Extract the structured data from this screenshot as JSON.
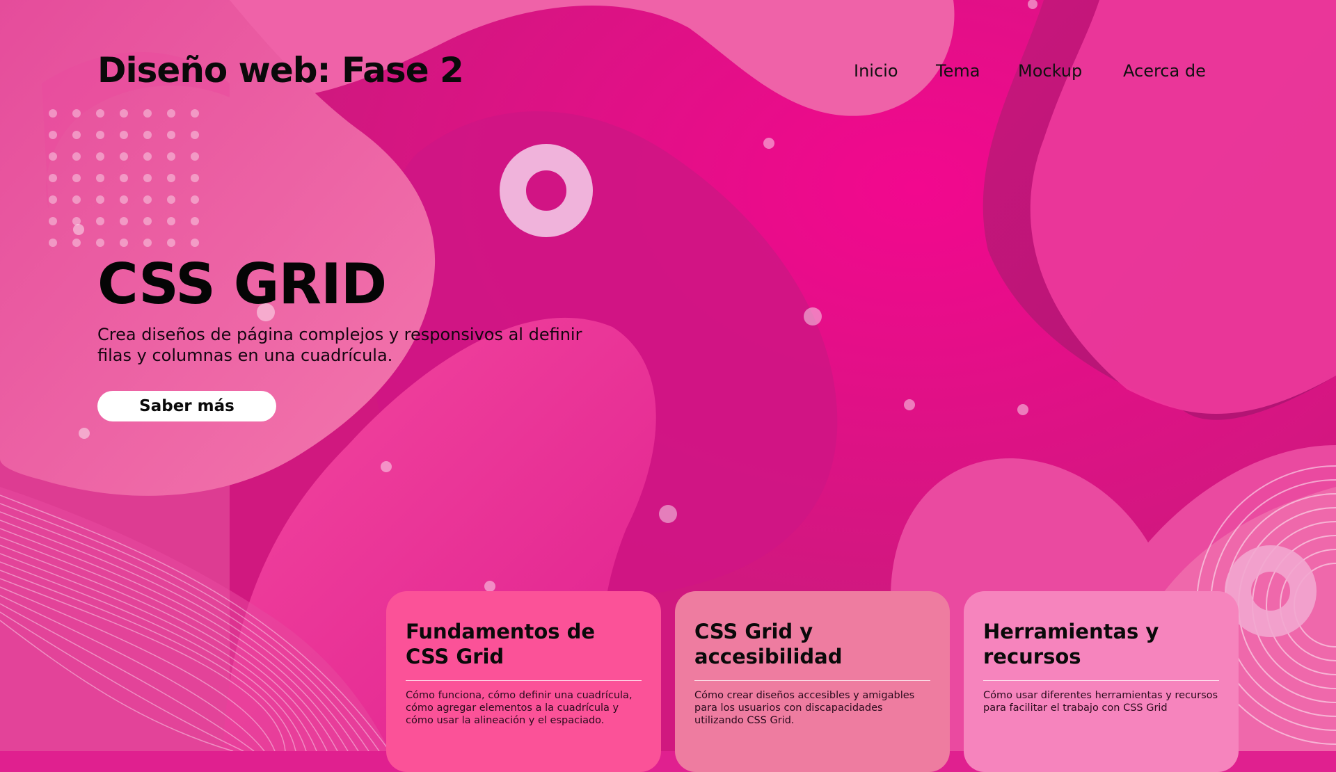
{
  "site": {
    "title": "Diseño web: Fase 2"
  },
  "nav": {
    "items": [
      "Inicio",
      "Tema",
      "Mockup",
      "Acerca de"
    ]
  },
  "hero": {
    "title": "CSS GRID",
    "description": "Crea diseños de página complejos y responsivos al definir filas y columnas en una cuadrícula.",
    "button": "Saber más"
  },
  "cards": [
    {
      "title": "Fundamentos de CSS Grid",
      "text": "Cómo funciona, cómo definir una cuadrícula, cómo agregar elementos a la cuadrícula y cómo usar la alineación y el espaciado.",
      "color": "#fb5298"
    },
    {
      "title": "CSS Grid y accesibilidad",
      "text": "Cómo crear diseños accesibles y amigables para los usuarios con discapacidades utilizando CSS Grid.",
      "color": "#ee7ca0"
    },
    {
      "title": "Herramientas y recursos",
      "text": "Cómo usar diferentes herramientas y recursos para facilitar el trabajo con CSS Grid",
      "color": "#f684bd"
    }
  ],
  "colors": {
    "background": "#e0208f",
    "accent_pink": "#ee0a8a",
    "blob_light": "#f06fa8",
    "ring": "#f0b3db",
    "button_bg": "#ffffff"
  }
}
